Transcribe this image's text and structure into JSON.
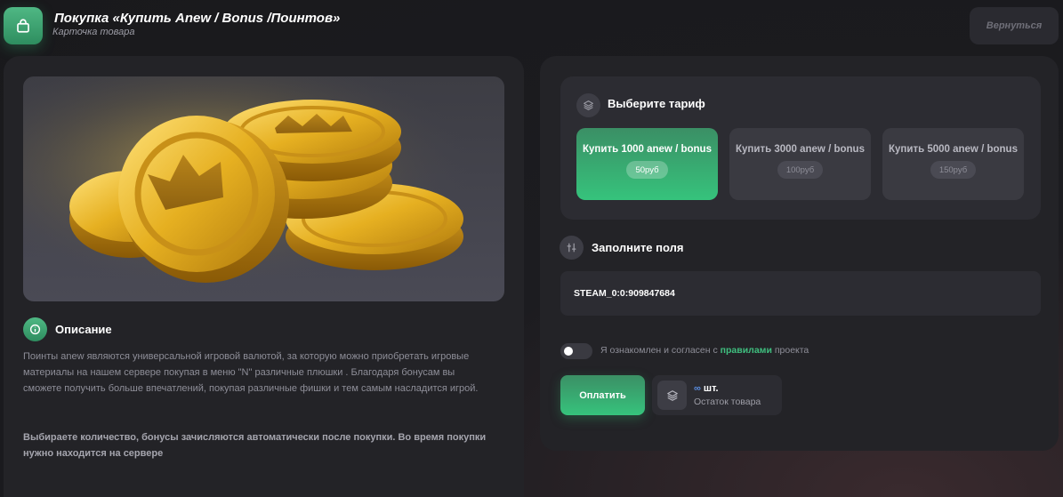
{
  "header": {
    "title": "Покупка «Купить  Anew / Bonus /Поинтов»",
    "subtitle": "Карточка товара",
    "back_label": "Вернуться",
    "bag_icon": "shopping-bag-icon"
  },
  "description": {
    "title": "Описание",
    "text": "Поинты anew являются универсальной игровой валютой, за которую можно приобретать игровые материалы на нашем сервере покупая в меню \"N\" различные плюшки . Благодаря бонусам вы сможете получить больше впечатлений, покупая различные фишки и тем самым насладится игрой.",
    "note": "Выбираете количество, бонусы зачисляются автоматически после покупки. Во время покупки нужно находится на сервере"
  },
  "tariffs": {
    "title": "Выберите тариф",
    "items": [
      {
        "label": "Купить 1000 anew / bonus",
        "price": "50руб",
        "selected": true
      },
      {
        "label": "Купить 3000 anew / bonus",
        "price": "100руб",
        "selected": false
      },
      {
        "label": "Купить 5000 anew / bonus",
        "price": "150руб",
        "selected": false
      }
    ]
  },
  "fields": {
    "title": "Заполните поля",
    "steam_value": "STEAM_0:0:909847684"
  },
  "agreement": {
    "prefix": "Я ознакомлен и согласен с ",
    "link": "правилами",
    "suffix": " проекта",
    "checked": false
  },
  "pay_label": "Оплатить",
  "stock": {
    "count": "∞",
    "unit": " шт.",
    "label": "Остаток товара"
  },
  "colors": {
    "accent": "#36c37c",
    "panel": "#232327",
    "background": "#19191c"
  }
}
